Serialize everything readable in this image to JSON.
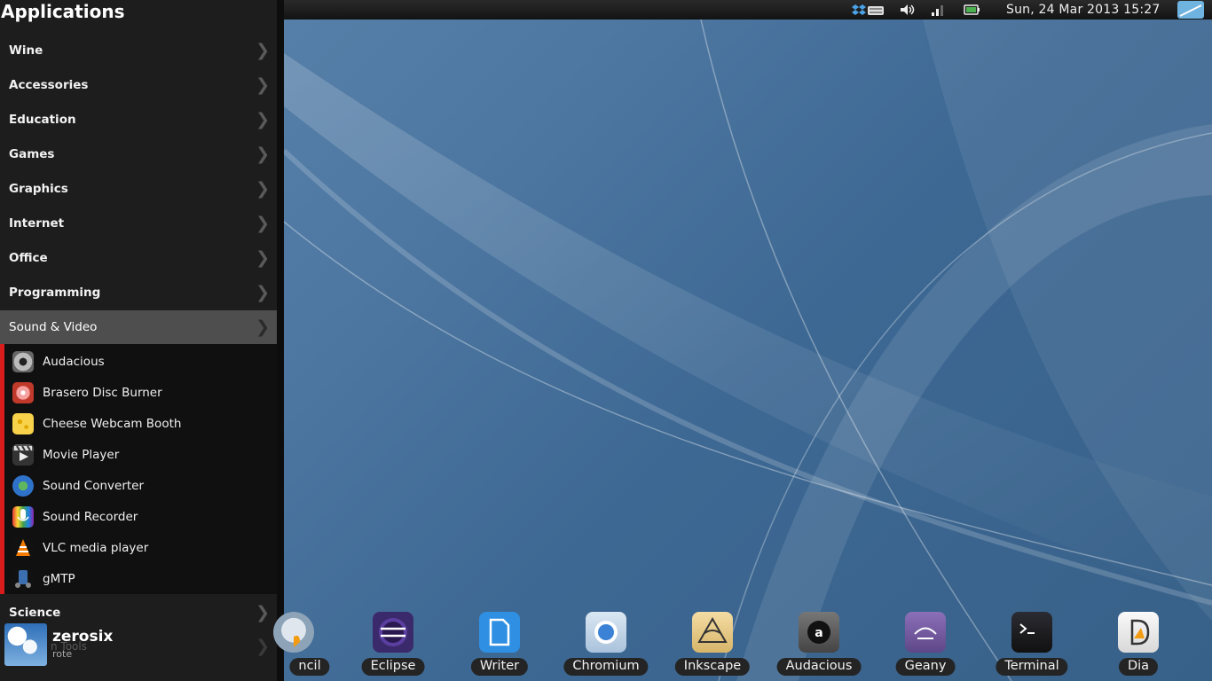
{
  "menu": {
    "title": "Applications",
    "categories_top": [
      "Wine",
      "Accessories",
      "Education",
      "Games",
      "Graphics",
      "Internet",
      "Office",
      "Programming"
    ],
    "active_category": "Sound & Video",
    "submenu_items": [
      {
        "label": "Audacious",
        "icon": "audacious-icon"
      },
      {
        "label": "Brasero Disc Burner",
        "icon": "brasero-icon"
      },
      {
        "label": "Cheese Webcam Booth",
        "icon": "cheese-icon"
      },
      {
        "label": "Movie Player",
        "icon": "movie-player-icon"
      },
      {
        "label": "Sound Converter",
        "icon": "sound-converter-icon"
      },
      {
        "label": "Sound Recorder",
        "icon": "sound-recorder-icon"
      },
      {
        "label": "VLC media player",
        "icon": "vlc-icon"
      },
      {
        "label": "gMTP",
        "icon": "gmtp-icon"
      }
    ],
    "categories_bottom": [
      "Science"
    ],
    "chevron": "❯",
    "user": {
      "name": "zerosix",
      "sub": "rote",
      "ghost": "n Tools"
    }
  },
  "panel": {
    "clock": "Sun, 24 Mar 2013 15:27",
    "tray": [
      "dropbox-icon",
      "keyboard-icon",
      "volume-icon",
      "signal-icon",
      "battery-icon",
      "user-switcher-icon"
    ]
  },
  "dock": [
    {
      "label": "ncil",
      "icon": "pencil-icon"
    },
    {
      "label": "Eclipse",
      "icon": "eclipse-icon"
    },
    {
      "label": "Writer",
      "icon": "writer-icon"
    },
    {
      "label": "Chromium",
      "icon": "chromium-icon"
    },
    {
      "label": "Inkscape",
      "icon": "inkscape-icon"
    },
    {
      "label": "Audacious",
      "icon": "audacious-icon"
    },
    {
      "label": "Geany",
      "icon": "geany-icon"
    },
    {
      "label": "Terminal",
      "icon": "terminal-icon"
    },
    {
      "label": "Dia",
      "icon": "dia-icon"
    }
  ],
  "colors": {
    "submenu_accent": "#d81b1b",
    "active_category_bg": "#4e4e4e",
    "menu_bg": "#1d1d1d"
  }
}
